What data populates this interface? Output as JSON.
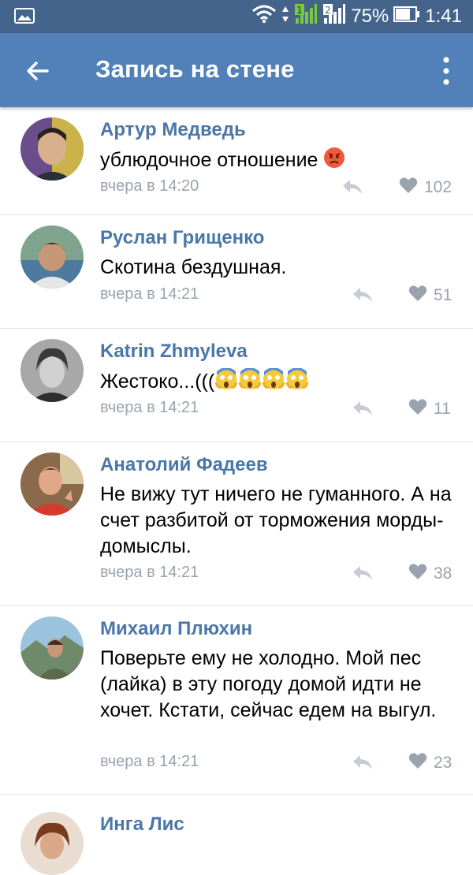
{
  "status_bar": {
    "icons": [
      "gallery-icon",
      "wifi-icon",
      "signal-sim1-icon",
      "signal-sim2-icon",
      "battery-icon"
    ],
    "battery": "75%",
    "time": "1:41"
  },
  "toolbar": {
    "title": "Запись на стене",
    "back_icon": "arrow-left-icon",
    "menu_icon": "more-vertical-icon"
  },
  "comments": [
    {
      "author": "Артур Медведь",
      "text": "ублюдочное отношение",
      "emoji": [
        "angry-face"
      ],
      "date": "вчера в 14:20",
      "likes": "102",
      "avatar_color": "#7a6a5e"
    },
    {
      "author": "Руслан Грищенко",
      "text": "Скотина бездушная.",
      "emoji": [],
      "date": "вчера в 14:21",
      "likes": "51",
      "avatar_color": "#6f8a7a"
    },
    {
      "author": "Katrin Zhmyleva",
      "text": "Жестоко...(((",
      "emoji": [
        "screaming-face",
        "screaming-face",
        "screaming-face",
        "screaming-face"
      ],
      "date": "вчера в 14:21",
      "likes": "11",
      "avatar_color": "#8e8e8e"
    },
    {
      "author": "Анатолий Фадеев",
      "text": "Не вижу тут ничего не гуманного. А на счет разбитой от торможения морды- домыслы.",
      "emoji": [],
      "date": "вчера в 14:21",
      "likes": "38",
      "avatar_color": "#c8463a"
    },
    {
      "author": "Михаил Плюхин",
      "text": "Поверьте ему не холодно. Мой пес (лайка) в эту погоду домой идти не хочет. Кстати, сейчас едем на выгул.",
      "emoji": [],
      "date": "вчера в 14:21",
      "likes": "23",
      "avatar_color": "#5e7d8a"
    },
    {
      "author": "Инга Лис",
      "text": "",
      "emoji": [],
      "date": "",
      "likes": "",
      "avatar_color": "#9a6a4a"
    }
  ]
}
